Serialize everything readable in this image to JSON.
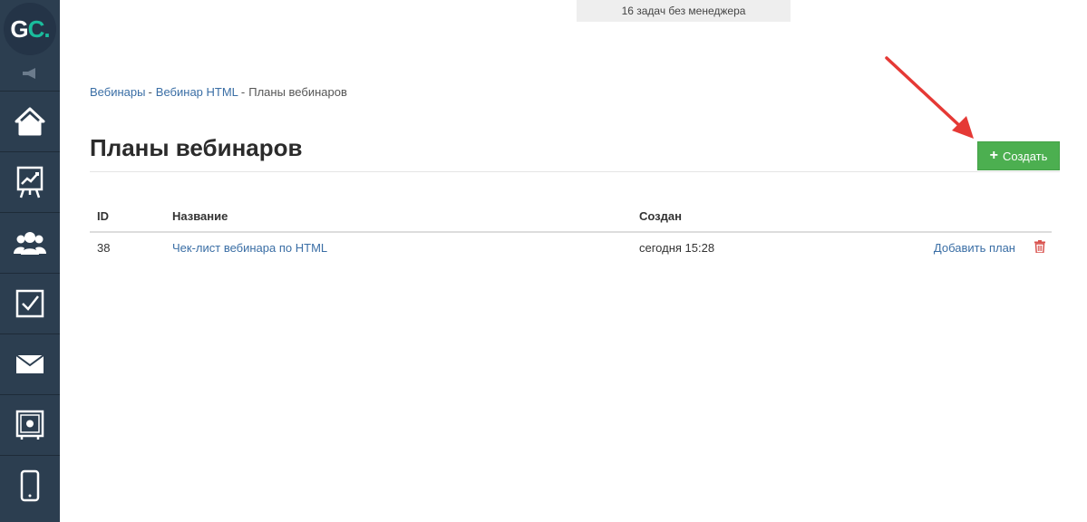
{
  "app": {
    "logo_text_g": "G",
    "logo_text_c": "C",
    "logo_dot": "."
  },
  "sidebar": {
    "items": [
      {
        "icon": "home-icon"
      },
      {
        "icon": "chart-icon"
      },
      {
        "icon": "users-icon"
      },
      {
        "icon": "checkbox-icon"
      },
      {
        "icon": "mail-icon"
      },
      {
        "icon": "safe-icon"
      },
      {
        "icon": "mobile-icon"
      }
    ]
  },
  "top_notice": "16 задач без менеджера",
  "breadcrumb": {
    "items": [
      "Вебинары",
      "Вебинар HTML",
      "Планы вебинаров"
    ],
    "separator": "-"
  },
  "page": {
    "title": "Планы вебинаров",
    "create_label": "Создать"
  },
  "table": {
    "headers": {
      "id": "ID",
      "name": "Название",
      "created": "Создан"
    },
    "rows": [
      {
        "id": "38",
        "name": "Чек-лист вебинара по HTML",
        "created": "сегодня 15:28",
        "action": "Добавить план"
      }
    ]
  },
  "colors": {
    "sidebar": "#2c3e50",
    "accent_green": "#4caf50",
    "link": "#3a6ea5",
    "annotation_red": "#e53935",
    "trash": "#d9534f"
  }
}
